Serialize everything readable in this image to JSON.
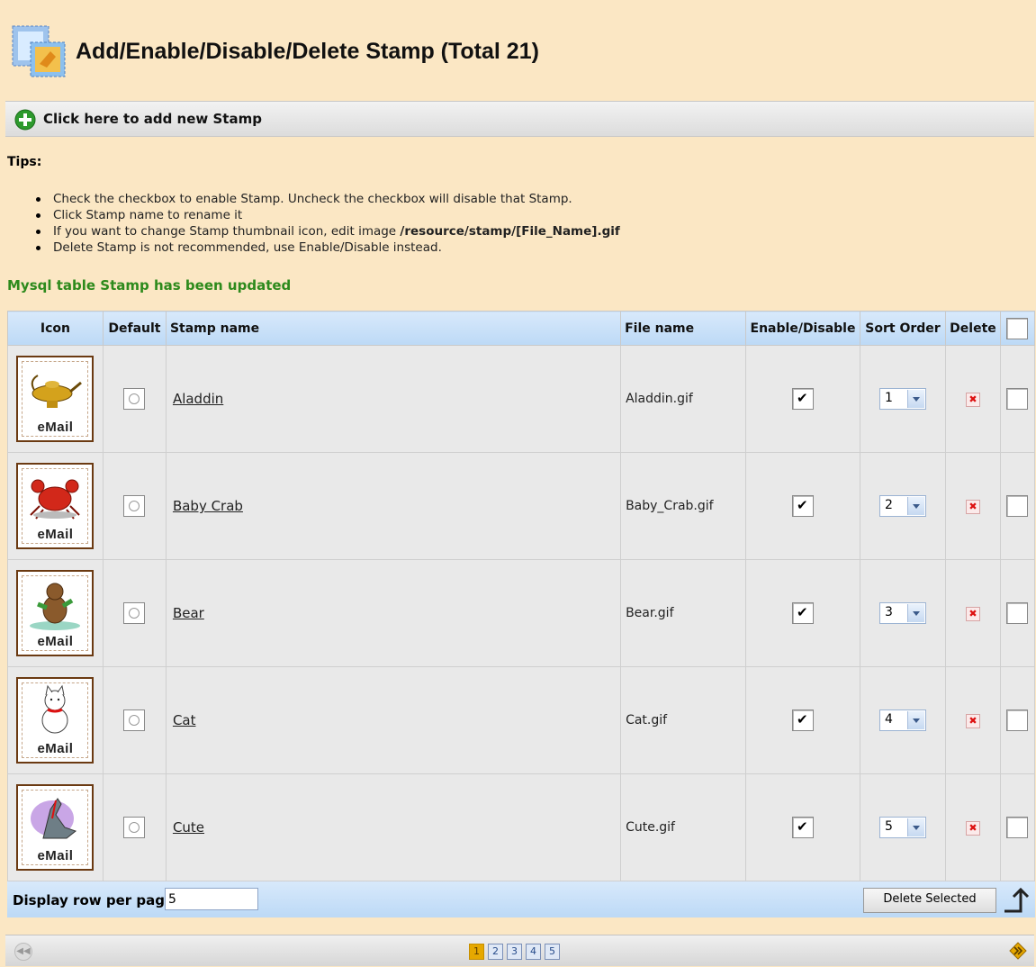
{
  "header": {
    "title": "Add/Enable/Disable/Delete Stamp (Total 21)",
    "logo_icon": "stamp-icon"
  },
  "add_bar": {
    "label": "Click here to add new Stamp",
    "icon": "plus-icon"
  },
  "tips": {
    "title": "Tips:",
    "items": [
      "Check the checkbox to enable Stamp. Uncheck the checkbox will disable that Stamp.",
      "Click Stamp name to rename it",
      "If you want to change Stamp thumbnail icon, edit image ",
      "Delete Stamp is not recommended, use Enable/Disable instead."
    ],
    "path_bold": "/resource/stamp/[File_Name].gif"
  },
  "status_message": "Mysql table Stamp has been updated",
  "table": {
    "headers": {
      "icon": "Icon",
      "default": "Default",
      "stamp_name": "Stamp name",
      "file_name": "File name",
      "enable": "Enable/Disable",
      "sort": "Sort Order",
      "delete": "Delete"
    },
    "rows": [
      {
        "stamp_tag": "eMail",
        "name": "Aladdin",
        "file": "Aladdin.gif",
        "sort": "1",
        "enabled": true,
        "icon": "lamp-icon"
      },
      {
        "stamp_tag": "eMail",
        "name": "Baby Crab",
        "file": "Baby_Crab.gif",
        "sort": "2",
        "enabled": true,
        "icon": "crab-icon"
      },
      {
        "stamp_tag": "eMail",
        "name": "Bear",
        "file": "Bear.gif",
        "sort": "3",
        "enabled": true,
        "icon": "bear-icon"
      },
      {
        "stamp_tag": "eMail",
        "name": "Cat",
        "file": "Cat.gif",
        "sort": "4",
        "enabled": true,
        "icon": "cat-icon"
      },
      {
        "stamp_tag": "eMail",
        "name": "Cute",
        "file": "Cute.gif",
        "sort": "5",
        "enabled": true,
        "icon": "dragon-icon"
      }
    ]
  },
  "footer": {
    "rows_label": "Display row per page",
    "rows_value": "5",
    "delete_selected": "Delete Selected"
  },
  "pager": {
    "pages": [
      "1",
      "2",
      "3",
      "4",
      "5"
    ],
    "current": "1"
  },
  "colors": {
    "page_bg": "#fbe7c4",
    "header_blue": "#bcd9f6",
    "status_green": "#2d8a1c",
    "current_page": "#e6a800"
  }
}
